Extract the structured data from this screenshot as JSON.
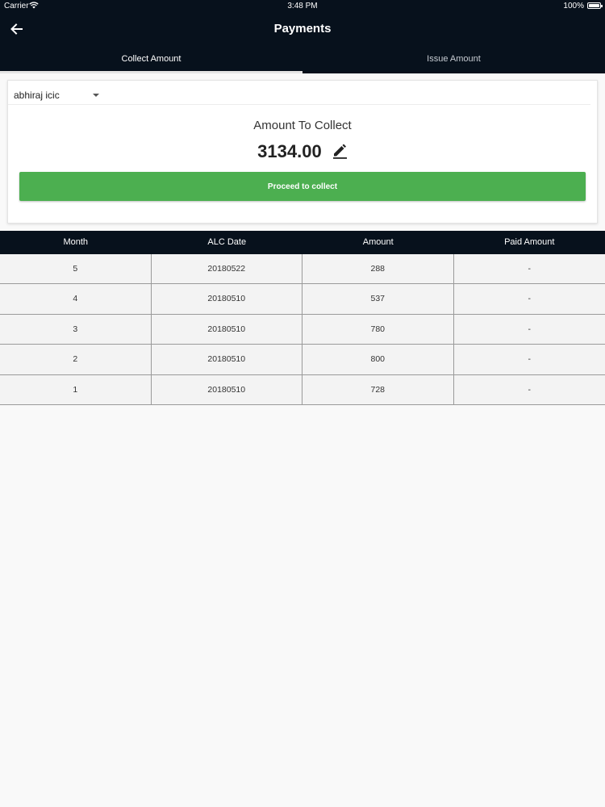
{
  "status_bar": {
    "carrier": "Carrier",
    "time": "3:48 PM",
    "battery": "100%"
  },
  "header": {
    "title": "Payments",
    "back_icon": "arrow-left-icon"
  },
  "tabs": [
    {
      "label": "Collect Amount",
      "active": true
    },
    {
      "label": "Issue Amount",
      "active": false
    }
  ],
  "collect_card": {
    "customer": "abhiraj icic",
    "amount_label": "Amount To Collect",
    "amount_value": "3134.00",
    "edit_icon": "pencil-icon",
    "proceed_label": "Proceed to collect",
    "proceed_color": "#4caf50"
  },
  "table": {
    "headers": [
      "Month",
      "ALC Date",
      "Amount",
      "Paid Amount"
    ],
    "rows": [
      [
        "5",
        "20180522",
        "288",
        "-"
      ],
      [
        "4",
        "20180510",
        "537",
        "-"
      ],
      [
        "3",
        "20180510",
        "780",
        "-"
      ],
      [
        "2",
        "20180510",
        "800",
        "-"
      ],
      [
        "1",
        "20180510",
        "728",
        "-"
      ]
    ]
  },
  "colors": {
    "header_bg": "#07111c",
    "accent_button": "#4caf50"
  }
}
